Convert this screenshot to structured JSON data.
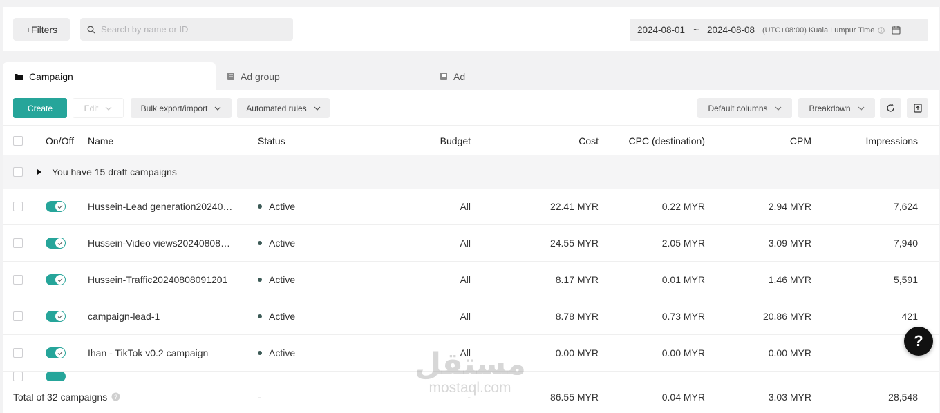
{
  "filters": {
    "add_label": "+Filters",
    "search_placeholder": "Search by name or ID"
  },
  "date": {
    "start": "2024-08-01",
    "sep": "~",
    "end": "2024-08-08",
    "timezone": "(UTC+08:00) Kuala Lumpur Time"
  },
  "tabs": [
    {
      "label": "Campaign",
      "icon": "folder-icon",
      "active": true
    },
    {
      "label": "Ad group",
      "icon": "adgroup-icon",
      "active": false
    },
    {
      "label": "Ad",
      "icon": "ad-icon",
      "active": false
    }
  ],
  "toolbar": {
    "create": "Create",
    "edit": "Edit",
    "bulk": "Bulk export/import",
    "automated": "Automated rules",
    "columns": "Default columns",
    "breakdown": "Breakdown"
  },
  "table": {
    "headers": {
      "onoff": "On/Off",
      "name": "Name",
      "status": "Status",
      "budget": "Budget",
      "cost": "Cost",
      "cpc": "CPC (destination)",
      "cpm": "CPM",
      "impressions": "Impressions"
    },
    "draft_text": "You have 15 draft campaigns",
    "rows": [
      {
        "name": "Hussein-Lead generation20240…",
        "status": "Active",
        "budget": "All",
        "cost": "22.41 MYR",
        "cpc": "0.22 MYR",
        "cpm": "2.94 MYR",
        "impressions": "7,624"
      },
      {
        "name": "Hussein-Video views20240808…",
        "status": "Active",
        "budget": "All",
        "cost": "24.55 MYR",
        "cpc": "2.05 MYR",
        "cpm": "3.09 MYR",
        "impressions": "7,940"
      },
      {
        "name": "Hussein-Traffic20240808091201",
        "status": "Active",
        "budget": "All",
        "cost": "8.17 MYR",
        "cpc": "0.01 MYR",
        "cpm": "1.46 MYR",
        "impressions": "5,591"
      },
      {
        "name": "campaign-lead-1",
        "status": "Active",
        "budget": "All",
        "cost": "8.78 MYR",
        "cpc": "0.73 MYR",
        "cpm": "20.86 MYR",
        "impressions": "421"
      },
      {
        "name": "Ihan - TikTok v0.2 campaign",
        "status": "Active",
        "budget": "All",
        "cost": "0.00 MYR",
        "cpc": "0.00 MYR",
        "cpm": "0.00 MYR",
        "impressions": ""
      }
    ],
    "total": {
      "label": "Total of 32 campaigns",
      "status": "-",
      "budget": "-",
      "cost": "86.55 MYR",
      "cpc": "0.04 MYR",
      "cpm": "3.03 MYR",
      "impressions": "28,548"
    }
  },
  "help": "?",
  "watermark": {
    "arabic": "مستقل",
    "latin": "mostaql.com"
  },
  "colors": {
    "accent": "#26a59a"
  }
}
